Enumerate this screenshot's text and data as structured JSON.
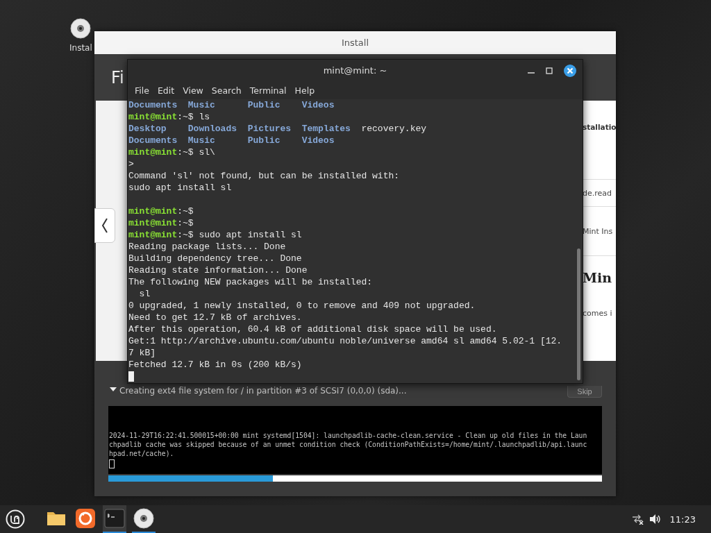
{
  "desktop": {
    "icons": [
      {
        "label": "Instal"
      }
    ]
  },
  "installer": {
    "title": "Install",
    "heading": "Fi",
    "slide_texts": [
      {
        "kind": "small",
        "text": "stallatio",
        "rule_after": true
      },
      {
        "kind": "body",
        "text": "de.read",
        "rule_after": true
      },
      {
        "kind": "body",
        "text": "Mint Ins",
        "rule_after": true
      },
      {
        "kind": "title",
        "text": "Min",
        "rule_after": false
      },
      {
        "kind": "body",
        "text": "comes i",
        "rule_after": false
      }
    ],
    "status": {
      "expanded": true,
      "text": "Creating ext4 file system for / in partition #3 of SCSI7 (0,0,0) (sda)..."
    },
    "skip_button": {
      "label": "Skip",
      "disabled": true
    },
    "log": {
      "lines": [
        "2024-11-29T16:22:41.500015+00:00 mint systemd[1504]: launchpadlib-cache-clean.service - Clean up old files in the Laun",
        "chpadlib cache was skipped because of an unmet condition check (ConditionPathExists=/home/mint/.launchpadlib/api.launc",
        "hpad.net/cache)."
      ],
      "cursor": true
    },
    "progress": {
      "level": 0.333
    }
  },
  "terminal": {
    "title": "mint@mint: ~",
    "menu": [
      "File",
      "Edit",
      "View",
      "Search",
      "Terminal",
      "Help"
    ],
    "lines": [
      {
        "kind": "text",
        "segments": [
          {
            "kind": "dir",
            "text": "Documents  Music      Public    Videos"
          }
        ]
      },
      {
        "kind": "text",
        "segments": [
          {
            "kind": "prompt",
            "text": "mint@mint"
          },
          {
            "kind": "plain",
            "text": ":~$ ls"
          }
        ]
      },
      {
        "kind": "text",
        "segments": [
          {
            "kind": "dir",
            "text": "Desktop    Downloads  Pictures  Templates"
          },
          {
            "kind": "plain",
            "text": "  recovery.key"
          }
        ]
      },
      {
        "kind": "text",
        "segments": [
          {
            "kind": "dir",
            "text": "Documents  Music      Public    Videos"
          }
        ]
      },
      {
        "kind": "text",
        "segments": [
          {
            "kind": "prompt",
            "text": "mint@mint"
          },
          {
            "kind": "plain",
            "text": ":~$ sl\\"
          }
        ]
      },
      {
        "kind": "text",
        "segments": [
          {
            "kind": "plain",
            "text": ">"
          }
        ]
      },
      {
        "kind": "text",
        "segments": [
          {
            "kind": "plain",
            "text": "Command 'sl' not found, but can be installed with:"
          }
        ]
      },
      {
        "kind": "text",
        "segments": [
          {
            "kind": "plain",
            "text": "sudo apt install sl"
          }
        ]
      },
      {
        "kind": "blank"
      },
      {
        "kind": "text",
        "segments": [
          {
            "kind": "prompt",
            "text": "mint@mint"
          },
          {
            "kind": "plain",
            "text": ":~$"
          }
        ]
      },
      {
        "kind": "text",
        "segments": [
          {
            "kind": "prompt",
            "text": "mint@mint"
          },
          {
            "kind": "plain",
            "text": ":~$"
          }
        ]
      },
      {
        "kind": "text",
        "segments": [
          {
            "kind": "prompt",
            "text": "mint@mint"
          },
          {
            "kind": "plain",
            "text": ":~$ sudo apt install sl"
          }
        ]
      },
      {
        "kind": "text",
        "segments": [
          {
            "kind": "plain",
            "text": "Reading package lists... Done"
          }
        ]
      },
      {
        "kind": "text",
        "segments": [
          {
            "kind": "plain",
            "text": "Building dependency tree... Done"
          }
        ]
      },
      {
        "kind": "text",
        "segments": [
          {
            "kind": "plain",
            "text": "Reading state information... Done"
          }
        ]
      },
      {
        "kind": "text",
        "segments": [
          {
            "kind": "plain",
            "text": "The following NEW packages will be installed:"
          }
        ]
      },
      {
        "kind": "text",
        "segments": [
          {
            "kind": "plain",
            "text": "  sl"
          }
        ]
      },
      {
        "kind": "text",
        "segments": [
          {
            "kind": "plain",
            "text": "0 upgraded, 1 newly installed, 0 to remove and 409 not upgraded."
          }
        ]
      },
      {
        "kind": "text",
        "segments": [
          {
            "kind": "plain",
            "text": "Need to get 12.7 kB of archives."
          }
        ]
      },
      {
        "kind": "text",
        "segments": [
          {
            "kind": "plain",
            "text": "After this operation, 60.4 kB of additional disk space will be used."
          }
        ]
      },
      {
        "kind": "text",
        "segments": [
          {
            "kind": "plain",
            "text": "Get:1 http://archive.ubuntu.com/ubuntu noble/universe amd64 sl amd64 5.02-1 [12."
          }
        ]
      },
      {
        "kind": "text",
        "segments": [
          {
            "kind": "plain",
            "text": "7 kB]"
          }
        ]
      },
      {
        "kind": "text",
        "segments": [
          {
            "kind": "plain",
            "text": "Fetched 12.7 kB in 0s (200 kB/s)"
          }
        ]
      }
    ],
    "cursor": true
  },
  "taskbar": {
    "launchers": [
      {
        "kind": "folder",
        "running": false,
        "active": false
      },
      {
        "kind": "browser",
        "running": false,
        "active": false
      },
      {
        "kind": "terminal",
        "running": true,
        "active": true
      },
      {
        "kind": "disc",
        "running": true,
        "active": false
      }
    ],
    "clock": "11:23"
  }
}
